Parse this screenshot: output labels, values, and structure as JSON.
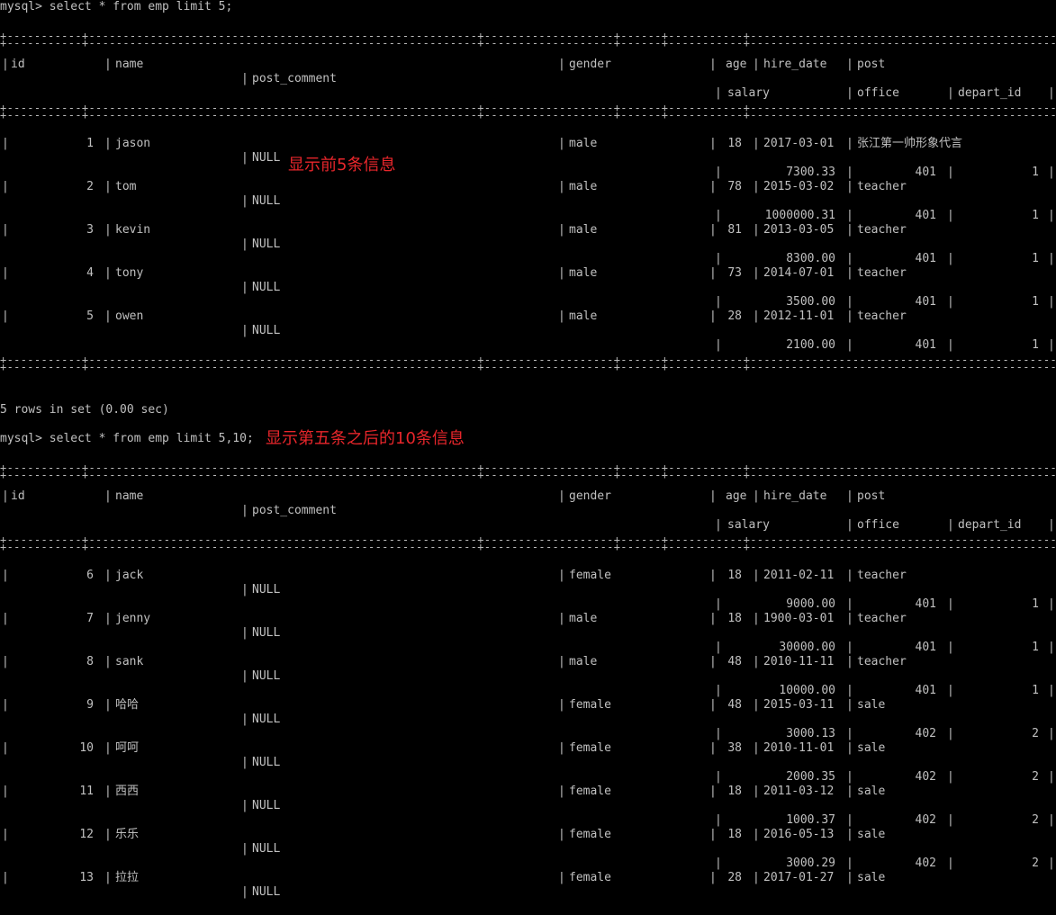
{
  "terminal": {
    "query1": {
      "prompt": "mysql>",
      "command": "select * from emp limit 5;",
      "annotation": "显示前5条信息"
    },
    "query2": {
      "prompt": "mysql>",
      "command": "select * from emp limit 5,10;",
      "annotation": "显示第五条之后的10条信息"
    },
    "result1_footer": "5 rows in set (0.00 sec)",
    "border_line": "+-----------+---------------------------------------------------------+-------------------+------+-----------+---------------------------------------------------------------+"
  },
  "table": {
    "headers": {
      "id": "id",
      "name": "name",
      "post_comment": "post_comment",
      "gender": "gender",
      "age": "age",
      "hire_date": "hire_date",
      "post": "post",
      "salary": "salary",
      "office": "office",
      "depart_id": "depart_id"
    }
  },
  "result1": {
    "rows": [
      {
        "id": "1",
        "name": "jason",
        "gender": "male",
        "age": "18",
        "hire_date": "2017-03-01",
        "post": "张江第一帅形象代言",
        "post_comment": "NULL",
        "salary": "7300.33",
        "office": "401",
        "depart_id": "1"
      },
      {
        "id": "2",
        "name": "tom",
        "gender": "male",
        "age": "78",
        "hire_date": "2015-03-02",
        "post": "teacher",
        "post_comment": "NULL",
        "salary": "1000000.31",
        "office": "401",
        "depart_id": "1"
      },
      {
        "id": "3",
        "name": "kevin",
        "gender": "male",
        "age": "81",
        "hire_date": "2013-03-05",
        "post": "teacher",
        "post_comment": "NULL",
        "salary": "8300.00",
        "office": "401",
        "depart_id": "1"
      },
      {
        "id": "4",
        "name": "tony",
        "gender": "male",
        "age": "73",
        "hire_date": "2014-07-01",
        "post": "teacher",
        "post_comment": "NULL",
        "salary": "3500.00",
        "office": "401",
        "depart_id": "1"
      },
      {
        "id": "5",
        "name": "owen",
        "gender": "male",
        "age": "28",
        "hire_date": "2012-11-01",
        "post": "teacher",
        "post_comment": "NULL",
        "salary": "2100.00",
        "office": "401",
        "depart_id": "1"
      }
    ]
  },
  "result2": {
    "rows": [
      {
        "id": "6",
        "name": "jack",
        "gender": "female",
        "age": "18",
        "hire_date": "2011-02-11",
        "post": "teacher",
        "post_comment": "NULL",
        "salary": "9000.00",
        "office": "401",
        "depart_id": "1"
      },
      {
        "id": "7",
        "name": "jenny",
        "gender": "male",
        "age": "18",
        "hire_date": "1900-03-01",
        "post": "teacher",
        "post_comment": "NULL",
        "salary": "30000.00",
        "office": "401",
        "depart_id": "1"
      },
      {
        "id": "8",
        "name": "sank",
        "gender": "male",
        "age": "48",
        "hire_date": "2010-11-11",
        "post": "teacher",
        "post_comment": "NULL",
        "salary": "10000.00",
        "office": "401",
        "depart_id": "1"
      },
      {
        "id": "9",
        "name": "哈哈",
        "gender": "female",
        "age": "48",
        "hire_date": "2015-03-11",
        "post": "sale",
        "post_comment": "NULL",
        "salary": "3000.13",
        "office": "402",
        "depart_id": "2"
      },
      {
        "id": "10",
        "name": "呵呵",
        "gender": "female",
        "age": "38",
        "hire_date": "2010-11-01",
        "post": "sale",
        "post_comment": "NULL",
        "salary": "2000.35",
        "office": "402",
        "depart_id": "2"
      },
      {
        "id": "11",
        "name": "西西",
        "gender": "female",
        "age": "18",
        "hire_date": "2011-03-12",
        "post": "sale",
        "post_comment": "NULL",
        "salary": "1000.37",
        "office": "402",
        "depart_id": "2"
      },
      {
        "id": "12",
        "name": "乐乐",
        "gender": "female",
        "age": "18",
        "hire_date": "2016-05-13",
        "post": "sale",
        "post_comment": "NULL",
        "salary": "3000.29",
        "office": "402",
        "depart_id": "2"
      },
      {
        "id": "13",
        "name": "拉拉",
        "gender": "female",
        "age": "28",
        "hire_date": "2017-01-27",
        "post": "sale",
        "post_comment": "NULL"
      }
    ]
  }
}
